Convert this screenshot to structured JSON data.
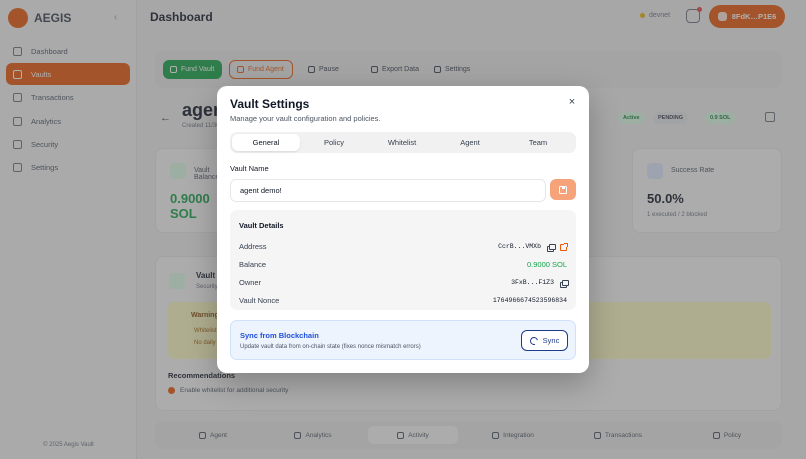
{
  "app": {
    "brand": "AEGIS",
    "page_title": "Dashboard",
    "copyright": "© 2025 Aegis Vault",
    "network": "devnet",
    "wallet_label": "8FdK…P1E6"
  },
  "sidebar": {
    "items": [
      {
        "label": "Dashboard",
        "active": false
      },
      {
        "label": "Vaults",
        "active": true
      },
      {
        "label": "Transactions",
        "active": false
      },
      {
        "label": "Analytics",
        "active": false
      },
      {
        "label": "Security",
        "active": false
      },
      {
        "label": "Settings",
        "active": false
      }
    ]
  },
  "actions": {
    "fund_vault": "Fund Vault",
    "fund_agent": "Fund Agent",
    "pause": "Pause",
    "export": "Export Data",
    "settings": "Settings"
  },
  "vault_header": {
    "name": "agent demo!",
    "created": "Created 11/30/2025",
    "badges": [
      "Active",
      "PENDING",
      "0.9 SOL"
    ]
  },
  "stats": {
    "vault_balance": {
      "label": "Vault Balance",
      "value": "0.9000 SOL",
      "sub": ""
    },
    "success_rate": {
      "label": "Success Rate",
      "value": "50.0%",
      "sub": "1 executed / 2 blocked"
    }
  },
  "health": {
    "title": "Vault Health",
    "subtitle": "Security and configuration status",
    "warning_title": "Warnings",
    "warnings": [
      "Whitelist is empty",
      "No daily limit configured"
    ],
    "recommendations_title": "Recommendations",
    "recommendation": "Enable whitelist for additional security"
  },
  "bottom_tabs": [
    {
      "label": "Agent",
      "active": false
    },
    {
      "label": "Analytics",
      "active": false
    },
    {
      "label": "Activity",
      "active": true
    },
    {
      "label": "Integration",
      "active": false
    },
    {
      "label": "Transactions",
      "active": false
    },
    {
      "label": "Policy",
      "active": false
    }
  ],
  "modal": {
    "title": "Vault Settings",
    "subtitle": "Manage your vault configuration and policies.",
    "close_icon": "×",
    "tabs": [
      {
        "label": "General",
        "active": true
      },
      {
        "label": "Policy",
        "active": false
      },
      {
        "label": "Whitelist",
        "active": false
      },
      {
        "label": "Agent",
        "active": false
      },
      {
        "label": "Team",
        "active": false
      }
    ],
    "vault_name_label": "Vault Name",
    "vault_name_value": "agent demo!",
    "details": {
      "title": "Vault Details",
      "address_label": "Address",
      "address_value": "CcrB...VMXb",
      "balance_label": "Balance",
      "balance_value": "0.9000 SOL",
      "owner_label": "Owner",
      "owner_value": "3FxB...F1Z3",
      "nonce_label": "Vault Nonce",
      "nonce_value": "1764966674523596834"
    },
    "sync": {
      "title": "Sync from Blockchain",
      "subtitle": "Update vault data from on-chain state (fixes nonce mismatch errors)",
      "button_label": "Sync"
    }
  },
  "colors": {
    "accent": "#ea580c",
    "success": "#16a34a",
    "sync_blue": "#1d4ed8",
    "overlay": "rgba(80,80,80,0.45)"
  }
}
